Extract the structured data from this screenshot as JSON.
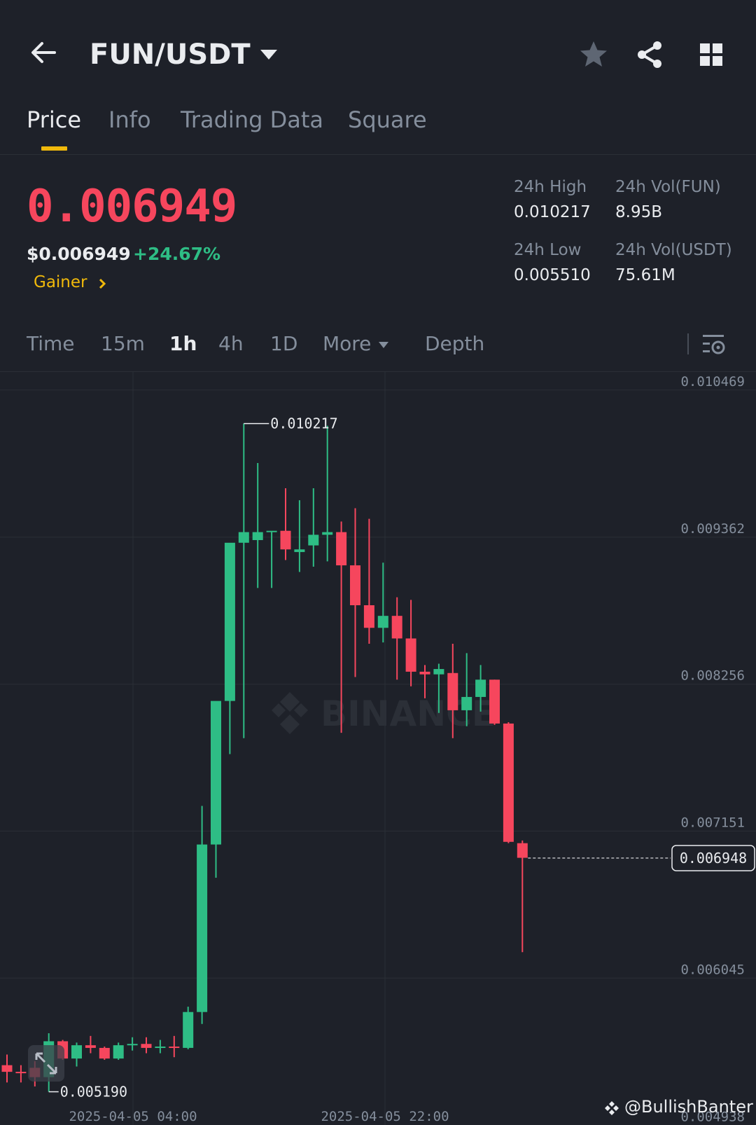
{
  "header": {
    "pair": "FUN/USDT",
    "icons": [
      "back-arrow-icon",
      "caret-down-icon",
      "star-icon",
      "share-icon",
      "grid-icon"
    ]
  },
  "tabs": [
    {
      "label": "Price",
      "active": true
    },
    {
      "label": "Info",
      "active": false
    },
    {
      "label": "Trading Data",
      "active": false
    },
    {
      "label": "Square",
      "active": false
    }
  ],
  "ticker": {
    "last_price": "0.006949",
    "usd_price": "$0.006949",
    "change_pct": "+24.67%",
    "tag": "Gainer",
    "high_label": "24h High",
    "high_value": "0.010217",
    "low_label": "24h Low",
    "low_value": "0.005510",
    "vol_base_label": "24h Vol(FUN)",
    "vol_base_value": "8.95B",
    "vol_quote_label": "24h Vol(USDT)",
    "vol_quote_value": "75.61M"
  },
  "intervals": [
    {
      "label": "Time",
      "active": false
    },
    {
      "label": "15m",
      "active": false
    },
    {
      "label": "1h",
      "active": true
    },
    {
      "label": "4h",
      "active": false
    },
    {
      "label": "1D",
      "active": false
    },
    {
      "label": "More",
      "active": false
    },
    {
      "label": "Depth",
      "active": false
    }
  ],
  "colors": {
    "up": "#2ebd85",
    "down": "#f6465d",
    "accent": "#f0b90b",
    "bg": "#1e2129"
  },
  "chart_data": {
    "type": "candlestick",
    "interval": "1h",
    "ylim": [
      0.00494,
      0.01061
    ],
    "y_ticks": [
      "0.010469",
      "0.009362",
      "0.008256",
      "0.007151",
      "0.006045",
      "0.004938"
    ],
    "x_ticks": [
      "2025-04-05 04:00",
      "2025-04-05 22:00"
    ],
    "high_marker": "0.010217",
    "low_marker": "0.005190",
    "current_price_tag": "0.006948",
    "watermark": "BINANCE",
    "credit": "@BullishBanter",
    "candles": [
      {
        "o": 0.00539,
        "h": 0.00547,
        "l": 0.00526,
        "c": 0.00534
      },
      {
        "o": 0.00534,
        "h": 0.00539,
        "l": 0.00526,
        "c": 0.00533
      },
      {
        "o": 0.00537,
        "h": 0.00542,
        "l": 0.00523,
        "c": 0.0053
      },
      {
        "o": 0.0053,
        "h": 0.00563,
        "l": 0.00519,
        "c": 0.00557
      },
      {
        "o": 0.00557,
        "h": 0.00558,
        "l": 0.00543,
        "c": 0.00544
      },
      {
        "o": 0.00544,
        "h": 0.00556,
        "l": 0.00538,
        "c": 0.00554
      },
      {
        "o": 0.00554,
        "h": 0.00561,
        "l": 0.00548,
        "c": 0.00552
      },
      {
        "o": 0.00552,
        "h": 0.00553,
        "l": 0.00543,
        "c": 0.00544
      },
      {
        "o": 0.00544,
        "h": 0.00556,
        "l": 0.00543,
        "c": 0.00554
      },
      {
        "o": 0.00554,
        "h": 0.0056,
        "l": 0.0055,
        "c": 0.00555
      },
      {
        "o": 0.00555,
        "h": 0.0056,
        "l": 0.00548,
        "c": 0.00552
      },
      {
        "o": 0.00552,
        "h": 0.00558,
        "l": 0.00548,
        "c": 0.00553
      },
      {
        "o": 0.00553,
        "h": 0.00561,
        "l": 0.00545,
        "c": 0.00552
      },
      {
        "o": 0.00552,
        "h": 0.00583,
        "l": 0.00551,
        "c": 0.00579
      },
      {
        "o": 0.00579,
        "h": 0.00734,
        "l": 0.0057,
        "c": 0.00705
      },
      {
        "o": 0.00705,
        "h": 0.0072,
        "l": 0.0068,
        "c": 0.00813
      },
      {
        "o": 0.00813,
        "h": 0.0082,
        "l": 0.00773,
        "c": 0.00932
      },
      {
        "o": 0.00932,
        "h": 0.010217,
        "l": 0.00785,
        "c": 0.0094
      },
      {
        "o": 0.00934,
        "h": 0.00992,
        "l": 0.00898,
        "c": 0.0094
      },
      {
        "o": 0.0094,
        "h": 0.0094,
        "l": 0.00898,
        "c": 0.00941
      },
      {
        "o": 0.00941,
        "h": 0.00973,
        "l": 0.00919,
        "c": 0.00927
      },
      {
        "o": 0.00925,
        "h": 0.00964,
        "l": 0.0091,
        "c": 0.00927
      },
      {
        "o": 0.0093,
        "h": 0.00973,
        "l": 0.00914,
        "c": 0.00938
      },
      {
        "o": 0.00938,
        "h": 0.0102,
        "l": 0.00918,
        "c": 0.0094
      },
      {
        "o": 0.0094,
        "h": 0.00948,
        "l": 0.00789,
        "c": 0.00915
      },
      {
        "o": 0.00915,
        "h": 0.00958,
        "l": 0.00831,
        "c": 0.00885
      },
      {
        "o": 0.00885,
        "h": 0.0095,
        "l": 0.00856,
        "c": 0.00868
      },
      {
        "o": 0.00868,
        "h": 0.00917,
        "l": 0.00857,
        "c": 0.00877
      },
      {
        "o": 0.00877,
        "h": 0.00891,
        "l": 0.00829,
        "c": 0.0086
      },
      {
        "o": 0.0086,
        "h": 0.00889,
        "l": 0.00824,
        "c": 0.00835
      },
      {
        "o": 0.00835,
        "h": 0.0084,
        "l": 0.00815,
        "c": 0.00833
      },
      {
        "o": 0.00833,
        "h": 0.00841,
        "l": 0.00804,
        "c": 0.00837
      },
      {
        "o": 0.00834,
        "h": 0.00856,
        "l": 0.00785,
        "c": 0.00806
      },
      {
        "o": 0.00806,
        "h": 0.00849,
        "l": 0.00794,
        "c": 0.00816
      },
      {
        "o": 0.00816,
        "h": 0.0084,
        "l": 0.00805,
        "c": 0.00829
      },
      {
        "o": 0.00829,
        "h": 0.00829,
        "l": 0.00795,
        "c": 0.00796
      },
      {
        "o": 0.00796,
        "h": 0.00797,
        "l": 0.00706,
        "c": 0.00707
      },
      {
        "o": 0.00706,
        "h": 0.00708,
        "l": 0.00624,
        "c": 0.00695
      }
    ]
  }
}
